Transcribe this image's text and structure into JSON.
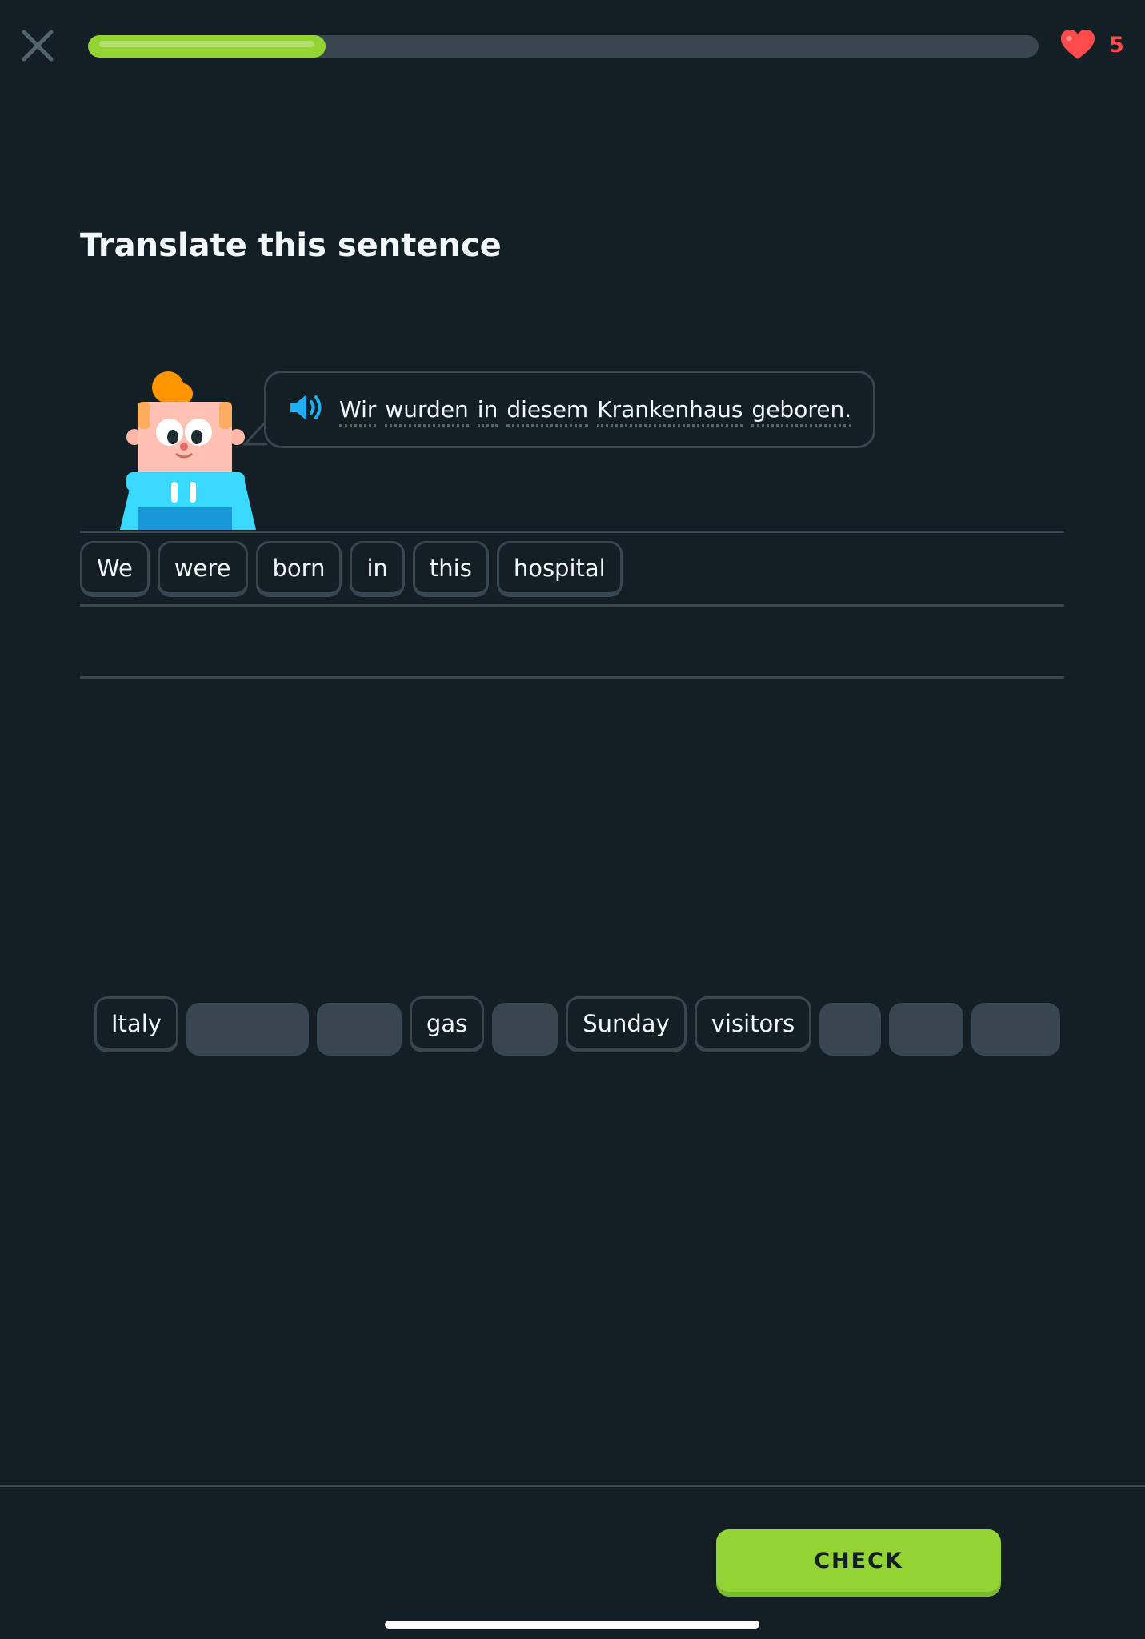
{
  "header": {
    "close_icon": "close-icon",
    "progress_fraction": 0.25,
    "hearts_count": "5",
    "heart_icon": "heart-icon"
  },
  "colors": {
    "background": "#131f24",
    "accent_green": "#93d333",
    "heart_red": "#ff4b4b",
    "chip_border": "#37464f"
  },
  "prompt": {
    "title": "Translate this sentence",
    "speaker_icon": "speaker-icon",
    "words": [
      "Wir",
      "wurden",
      "in",
      "diesem",
      "Krankenhaus",
      "geboren."
    ]
  },
  "answer_words": [
    "We",
    "were",
    "born",
    "in",
    "this",
    "hospital"
  ],
  "word_bank": [
    {
      "label": "Italy",
      "used": false
    },
    {
      "label": "",
      "used": true
    },
    {
      "label": "",
      "used": true
    },
    {
      "label": "gas",
      "used": false
    },
    {
      "label": "",
      "used": true
    },
    {
      "label": "Sunday",
      "used": false
    },
    {
      "label": "visitors",
      "used": false
    },
    {
      "label": "",
      "used": true
    },
    {
      "label": "",
      "used": true
    },
    {
      "label": "",
      "used": true
    }
  ],
  "footer": {
    "check_label": "CHECK"
  }
}
